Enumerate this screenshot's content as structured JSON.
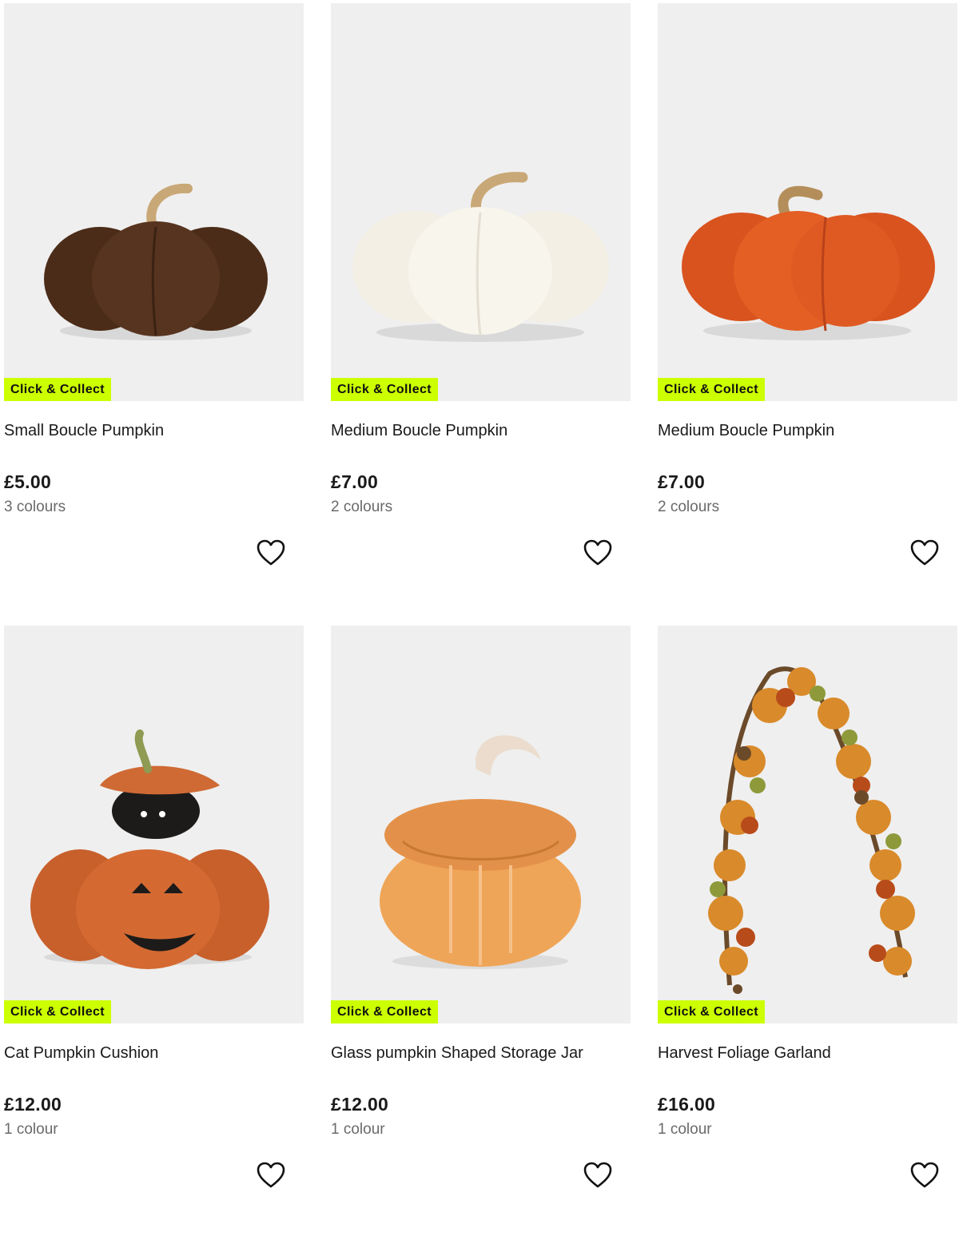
{
  "products": [
    {
      "name": "Small Boucle Pumpkin",
      "price": "£5.00",
      "colours": "3 colours",
      "badge": "Click & Collect",
      "image": "brown-boucle-pumpkin"
    },
    {
      "name": "Medium Boucle Pumpkin",
      "price": "£7.00",
      "colours": "2 colours",
      "badge": "Click & Collect",
      "image": "cream-boucle-pumpkin"
    },
    {
      "name": "Medium Boucle Pumpkin",
      "price": "£7.00",
      "colours": "2 colours",
      "badge": "Click & Collect",
      "image": "orange-boucle-pumpkin"
    },
    {
      "name": "Cat Pumpkin Cushion",
      "price": "£12.00",
      "colours": "1 colour",
      "badge": "Click & Collect",
      "image": "cat-pumpkin-cushion"
    },
    {
      "name": "Glass pumpkin Shaped Storage Jar",
      "price": "£12.00",
      "colours": "1 colour",
      "badge": "Click & Collect",
      "image": "glass-pumpkin-jar"
    },
    {
      "name": "Harvest Foliage Garland",
      "price": "£16.00",
      "colours": "1 colour",
      "badge": "Click & Collect",
      "image": "foliage-garland"
    }
  ],
  "colors": {
    "badge": "#ccff00",
    "image_bg": "#efefef",
    "muted_text": "#6a6a6a"
  },
  "icons": {
    "wishlist": "heart-outline-icon"
  }
}
